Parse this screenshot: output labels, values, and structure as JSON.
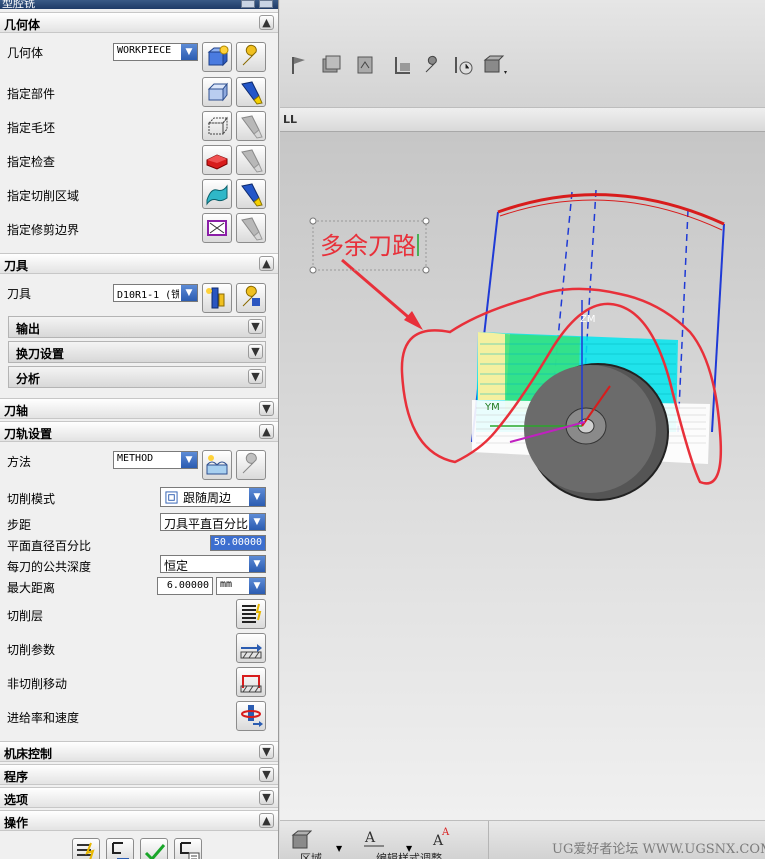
{
  "dialog": {
    "title": "型腔铣",
    "geometry": {
      "header": "几何体",
      "geometry_label": "几何体",
      "geometry_value": "WORKPIECE",
      "specify_part": "指定部件",
      "specify_blank": "指定毛坯",
      "specify_check": "指定检查",
      "specify_cut_area": "指定切削区域",
      "specify_trim_boundary": "指定修剪边界"
    },
    "tool": {
      "header": "刀具",
      "tool_label": "刀具",
      "tool_value": "D10R1-1 (铣",
      "output": "输出",
      "tool_change": "换刀设置",
      "analysis": "分析"
    },
    "tool_axis": {
      "header": "刀轴"
    },
    "path_settings": {
      "header": "刀轨设置",
      "method_label": "方法",
      "method_value": "METHOD",
      "cut_pattern_label": "切削模式",
      "cut_pattern_value": "跟随周边",
      "stepover_label": "步距",
      "stepover_value": "刀具平直百分比",
      "flat_diameter_label": "平面直径百分比",
      "flat_diameter_value": "50.00000",
      "common_depth_label": "每刀的公共深度",
      "common_depth_value": "恒定",
      "max_distance_label": "最大距离",
      "max_distance_value": "6.00000",
      "max_distance_unit": "mm",
      "cut_levels": "切削层",
      "cutting_params": "切削参数",
      "non_cutting_moves": "非切削移动",
      "feeds_speeds": "进给率和速度"
    },
    "machine_control": {
      "header": "机床控制"
    },
    "program": {
      "header": "程序"
    },
    "options": {
      "header": "选项"
    },
    "actions": {
      "header": "操作"
    }
  },
  "graphics": {
    "tab_title": "LL",
    "annotation": "多余刀路",
    "axis_labels": {
      "ym": "YM",
      "zm": "ZM"
    }
  },
  "bottom_toolbar": {
    "region_label": "区域",
    "edit_style_label": "编辑样式",
    "adjust_label": "调整"
  },
  "watermark": "UG爱好者论坛 WWW.UGSNX.COM",
  "colors": {
    "section_header": "#e3e3e3",
    "blue_accent": "#2b5cb1",
    "annotation_red": "#e8303a",
    "toolpath_cyan": "#00e5ee",
    "toolpath_blue": "#1f3ad6"
  }
}
